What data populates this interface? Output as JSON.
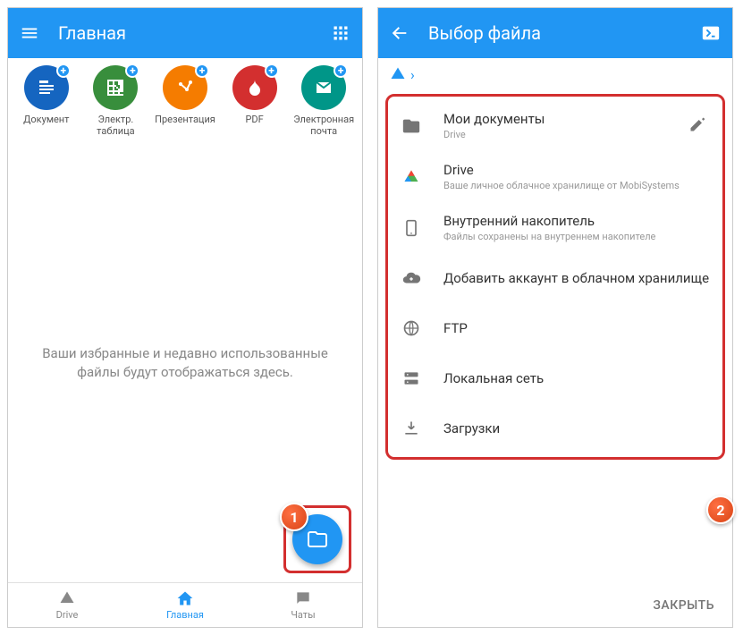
{
  "left": {
    "title": "Главная",
    "create": [
      {
        "label": "Документ"
      },
      {
        "label": "Электр. таблица"
      },
      {
        "label": "Презентация"
      },
      {
        "label": "PDF"
      },
      {
        "label": "Электронная почта"
      }
    ],
    "empty_text": "Ваши избранные и недавно использованные файлы будут отображаться здесь.",
    "nav": [
      {
        "label": "Drive"
      },
      {
        "label": "Главная"
      },
      {
        "label": "Чаты"
      }
    ]
  },
  "right": {
    "title": "Выбор файла",
    "storage": [
      {
        "title": "Мои документы",
        "sub": "Drive",
        "editable": true
      },
      {
        "title": "Drive",
        "sub": "Ваше личное облачное хранилище от MobiSystems"
      },
      {
        "title": "Внутренний накопитель",
        "sub": "Файлы сохранены на внутреннем накопителе"
      },
      {
        "title": "Добавить аккаунт в облачном хранилище"
      },
      {
        "title": "FTP"
      },
      {
        "title": "Локальная сеть"
      },
      {
        "title": "Загрузки"
      }
    ],
    "close": "ЗАКРЫТЬ"
  },
  "markers": {
    "m1": "1",
    "m2": "2"
  }
}
